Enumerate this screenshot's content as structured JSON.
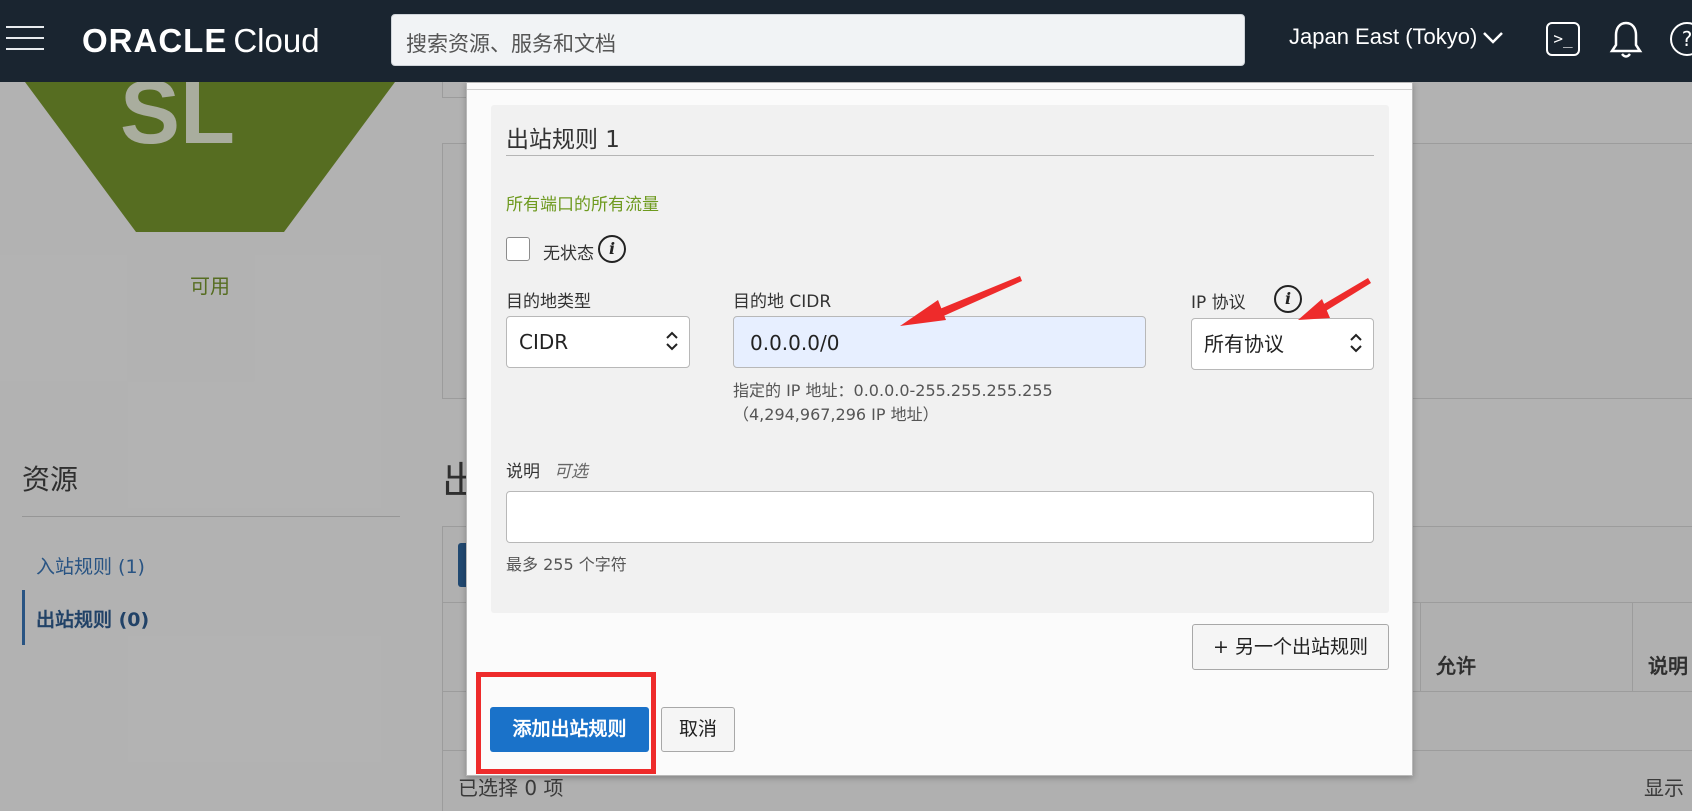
{
  "topbar": {
    "logo_oracle": "ORACLE",
    "logo_cloud": "Cloud",
    "search_placeholder": "搜索资源、服务和文档",
    "region": "Japan East (Tokyo)",
    "terminal_glyph": ">_",
    "help_glyph": "?"
  },
  "background": {
    "hex_text": "SL",
    "status": "可用",
    "resources_title": "资源",
    "nav": [
      {
        "label": "入站规则 (1)"
      },
      {
        "label": "出站规则 (0)"
      }
    ],
    "section_title_partial": "出",
    "table_headers": [
      "允许",
      "说明"
    ],
    "selected_count": "已选择 0 项",
    "show_label": "显示"
  },
  "modal": {
    "rule_title": "出站规则 1",
    "all_traffic": "所有端口的所有流量",
    "stateless_label": "无状态",
    "stateless_checked": false,
    "dest_type_label": "目的地类型",
    "dest_type_value": "CIDR",
    "dest_cidr_label": "目的地 CIDR",
    "dest_cidr_value": "0.0.0.0/0",
    "cidr_hint_1": "指定的 IP 地址：0.0.0.0-255.255.255.255",
    "cidr_hint_2": "（4,294,967,296 IP 地址）",
    "ip_protocol_label": "IP 协议",
    "ip_protocol_value": "所有协议",
    "desc_label": "说明",
    "desc_optional": "可选",
    "desc_value": "",
    "desc_hint": "最多 255 个字符",
    "another_rule_button": "+ 另一个出站规则",
    "add_button": "添加出站规则",
    "cancel_button": "取消"
  },
  "colors": {
    "topbar_bg": "#1a2530",
    "primary_button": "#1a72c9",
    "success_green": "#6e9a1f",
    "annotation_red": "#ee2b2b",
    "input_highlight": "#e7efff"
  }
}
